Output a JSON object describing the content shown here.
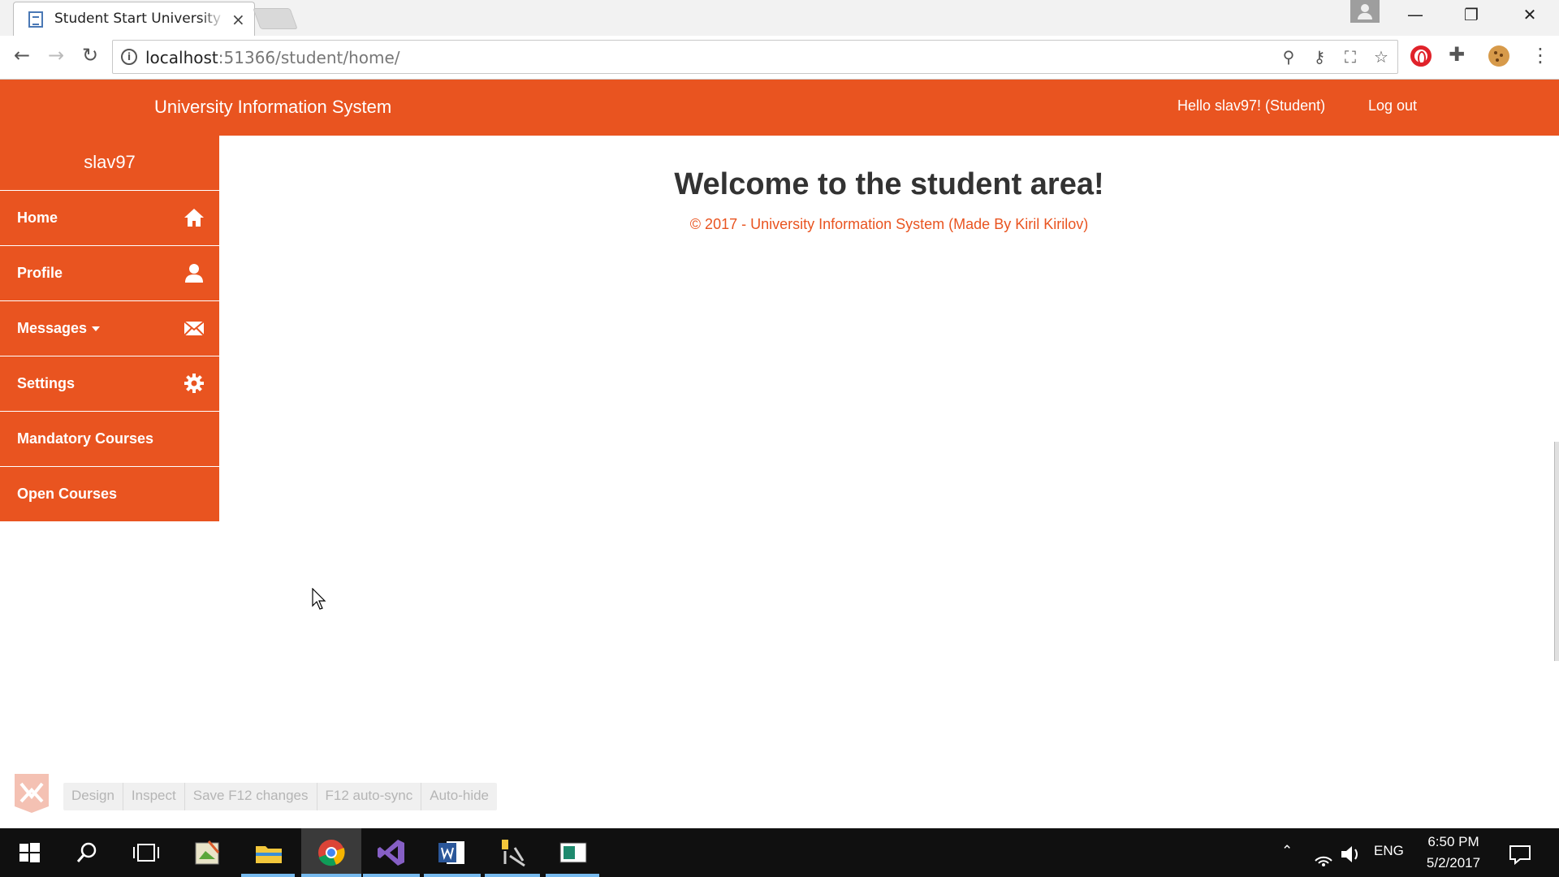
{
  "browser": {
    "tab_title": "Student Start University L",
    "tab_close": "×",
    "url_host": "localhost",
    "url_path": ":51366/student/home/",
    "info_glyph": "i",
    "window_controls": {
      "minimize": "—",
      "maximize": "❐",
      "close": "✕"
    }
  },
  "navbar": {
    "brand": "University Information System",
    "greeting": "Hello slav97! (Student)",
    "logout": "Log out",
    "color": "#e95420"
  },
  "sidebar": {
    "username": "slav97",
    "items": [
      {
        "label": "Home",
        "icon": "home-icon"
      },
      {
        "label": "Profile",
        "icon": "user-icon"
      },
      {
        "label": "Messages",
        "icon": "envelope-icon",
        "dropdown": true
      },
      {
        "label": "Settings",
        "icon": "gear-icon"
      },
      {
        "label": "Mandatory Courses",
        "icon": ""
      },
      {
        "label": "Open Courses",
        "icon": ""
      }
    ]
  },
  "main": {
    "heading": "Welcome to the student area!",
    "copyright": "© 2017 - University Information System (Made By Kiril Kirilov)"
  },
  "browser_link": {
    "buttons": [
      "Design",
      "Inspect",
      "Save F12 changes",
      "F12 auto-sync",
      "Auto-hide"
    ]
  },
  "taskbar": {
    "language": "ENG",
    "time": "6:50 PM",
    "date": "5/2/2017"
  }
}
